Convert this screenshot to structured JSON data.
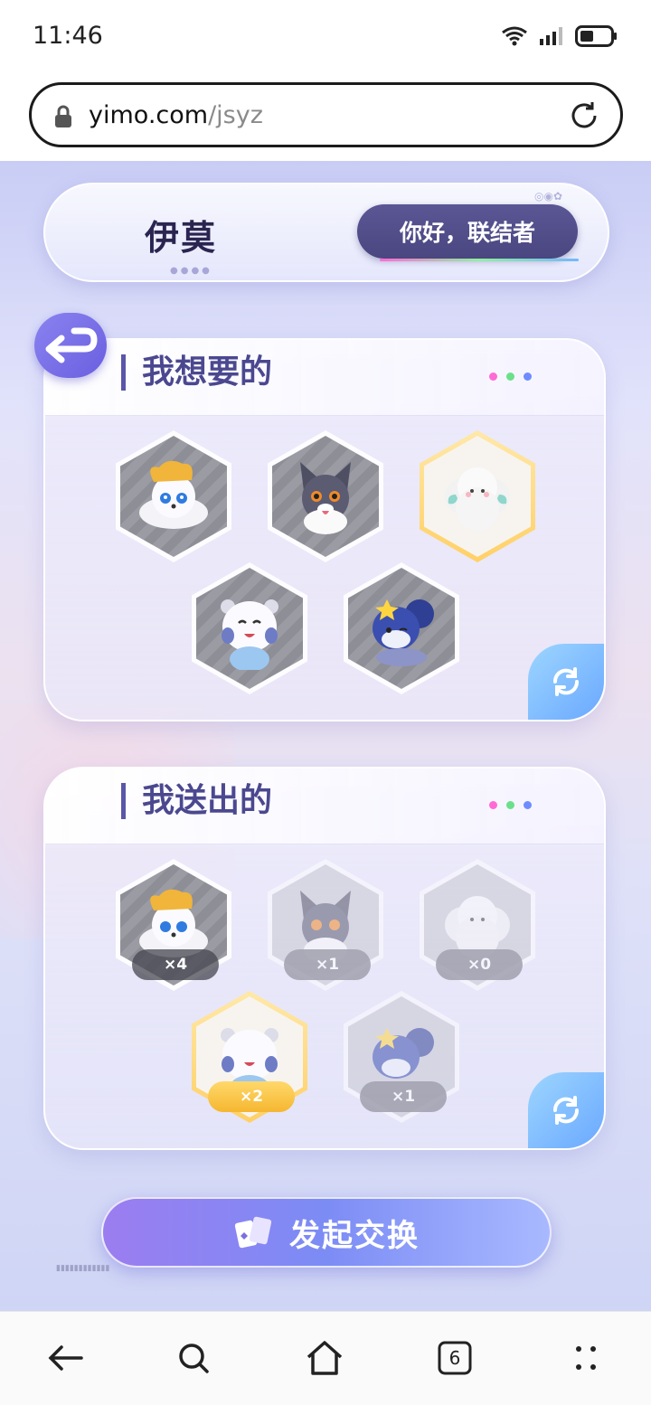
{
  "status_bar": {
    "time": "11:46"
  },
  "browser": {
    "url_domain": "yimo.com",
    "url_path": "/jsyz",
    "tab_count": "6"
  },
  "header": {
    "logo_text": "伊莫",
    "greeting": "你好，联结者"
  },
  "want_section": {
    "title": "我想要的",
    "pets": [
      {
        "icon": "white-fox-pet-icon",
        "selected": false
      },
      {
        "icon": "gray-wolf-pet-icon",
        "selected": false
      },
      {
        "icon": "fluffy-sheep-pet-icon",
        "selected": true
      },
      {
        "icon": "white-bear-pet-icon",
        "selected": false
      },
      {
        "icon": "blue-squirrel-pet-icon",
        "selected": false
      }
    ]
  },
  "give_section": {
    "title": "我送出的",
    "pets": [
      {
        "icon": "white-fox-pet-icon",
        "count": "×4",
        "selected": false
      },
      {
        "icon": "gray-wolf-pet-icon",
        "count": "×1",
        "selected": false
      },
      {
        "icon": "fluffy-sheep-pet-icon",
        "count": "×0",
        "selected": false
      },
      {
        "icon": "white-bear-pet-icon",
        "count": "×2",
        "selected": true
      },
      {
        "icon": "blue-squirrel-pet-icon",
        "count": "×1",
        "selected": false
      }
    ]
  },
  "actions": {
    "exchange_label": "发起交换"
  },
  "colors": {
    "accent": "#5b56a8",
    "button": "#8b84f0",
    "selected": "#ffd066"
  }
}
